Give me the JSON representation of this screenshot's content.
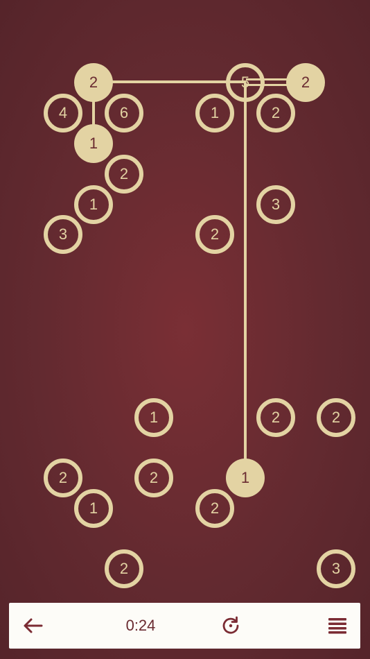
{
  "colors": {
    "accent": "#e3d3a3",
    "background": "#6a2b31",
    "toolbar_bg": "#fdfcf8",
    "toolbar_icon": "#7b2b33"
  },
  "nodes": [
    {
      "label": "2",
      "state": "done"
    },
    {
      "label": "5",
      "state": "open"
    },
    {
      "label": "2",
      "state": "done"
    },
    {
      "label": "4",
      "state": "open"
    },
    {
      "label": "6",
      "state": "open"
    },
    {
      "label": "1",
      "state": "open"
    },
    {
      "label": "2",
      "state": "open"
    },
    {
      "label": "1",
      "state": "done"
    },
    {
      "label": "2",
      "state": "open"
    },
    {
      "label": "1",
      "state": "open"
    },
    {
      "label": "3",
      "state": "open"
    },
    {
      "label": "3",
      "state": "open"
    },
    {
      "label": "2",
      "state": "open"
    },
    {
      "label": "1",
      "state": "open"
    },
    {
      "label": "2",
      "state": "open"
    },
    {
      "label": "2",
      "state": "open"
    },
    {
      "label": "2",
      "state": "open"
    },
    {
      "label": "2",
      "state": "open"
    },
    {
      "label": "1",
      "state": "done"
    },
    {
      "label": "1",
      "state": "open"
    },
    {
      "label": "2",
      "state": "open"
    },
    {
      "label": "2",
      "state": "open"
    },
    {
      "label": "3",
      "state": "open"
    }
  ],
  "toolbar": {
    "back_icon": "arrow-left-icon",
    "timer": "0:24",
    "restart_icon": "restart-icon",
    "menu_icon": "menu-icon"
  }
}
